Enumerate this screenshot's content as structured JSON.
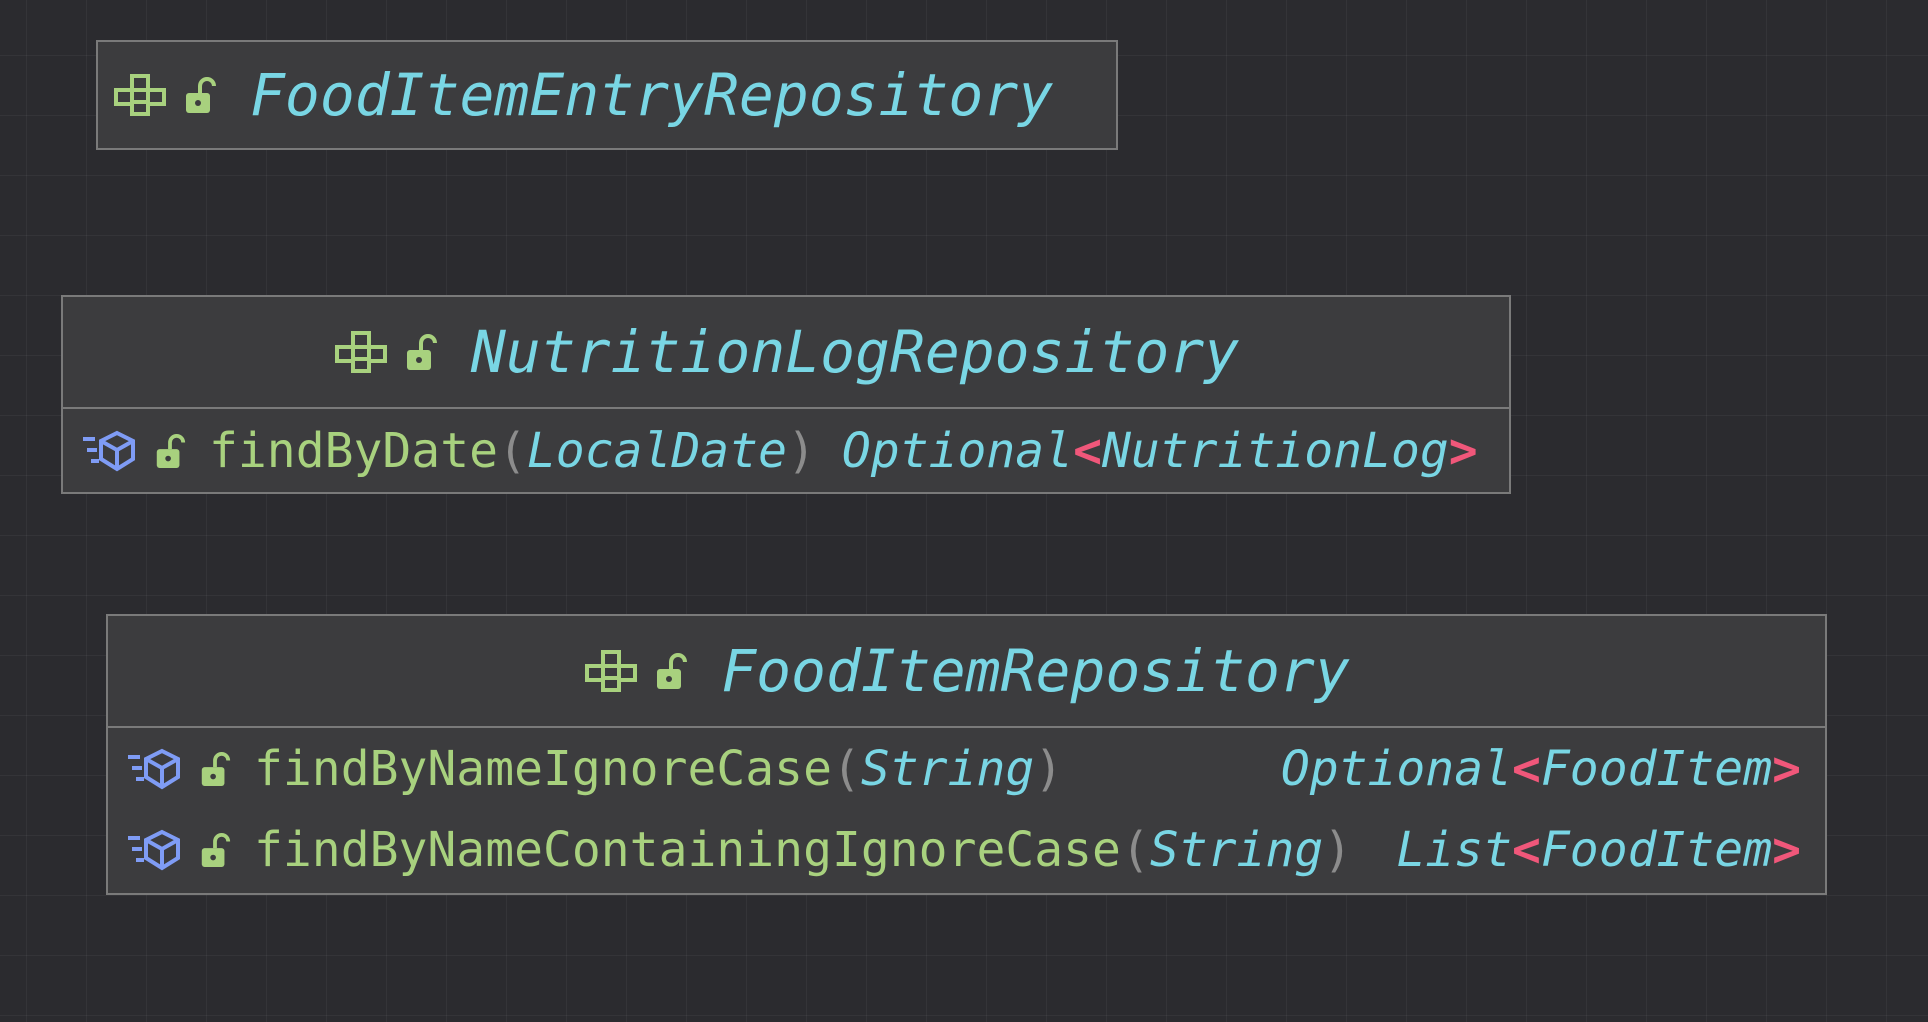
{
  "diagram": {
    "classes": [
      {
        "name": "FoodItemEntryRepository",
        "kind_icon": "interface-icon",
        "visibility_icon": "public-lock-icon",
        "methods": []
      },
      {
        "name": "NutritionLogRepository",
        "kind_icon": "interface-icon",
        "visibility_icon": "public-lock-icon",
        "methods": [
          {
            "name": "findByDate",
            "param": "LocalDate",
            "return_base": "Optional",
            "return_generic": "NutritionLog",
            "open_paren": "(",
            "close_paren": ")",
            "lt": "<",
            "gt": ">"
          }
        ]
      },
      {
        "name": "FoodItemRepository",
        "kind_icon": "interface-icon",
        "visibility_icon": "public-lock-icon",
        "methods": [
          {
            "name": "findByNameIgnoreCase",
            "param": "String",
            "return_base": "Optional",
            "return_generic": "FoodItem",
            "open_paren": "(",
            "close_paren": ")",
            "lt": "<",
            "gt": ">"
          },
          {
            "name": "findByNameContainingIgnoreCase",
            "param": "String",
            "return_base": "List",
            "return_generic": "FoodItem",
            "open_paren": "(",
            "close_paren": ")",
            "lt": "<",
            "gt": ">"
          }
        ]
      }
    ],
    "colors": {
      "background": "#2b2b2f",
      "box_fill": "#3c3c3e",
      "border": "#7a7a7a",
      "type_name": "#79d6e4",
      "method_name": "#a8d17e",
      "generic_bracket": "#f0577a",
      "paren": "#8c8c8c",
      "method_icon": "#7f9cf5"
    }
  }
}
